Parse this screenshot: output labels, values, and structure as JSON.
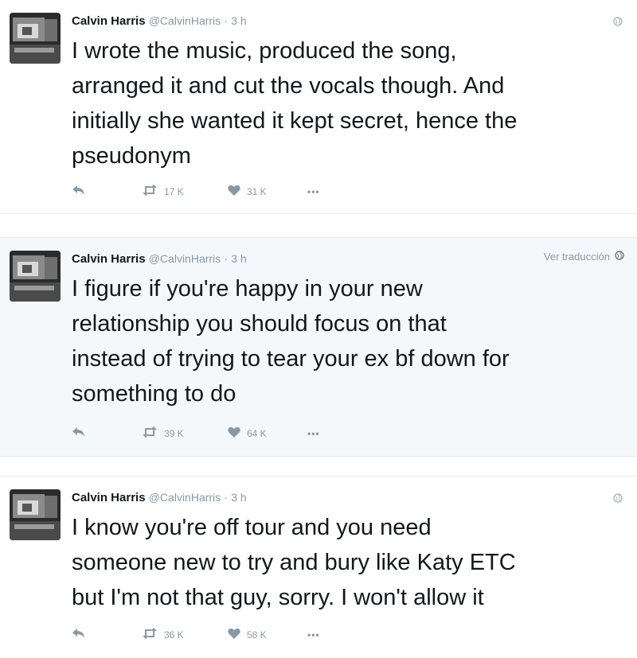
{
  "tweets": [
    {
      "name": "Calvin Harris",
      "handle": "@CalvinHarris",
      "separator": "·",
      "time": "3 h",
      "text": "I wrote the music, produced the song,\narranged it and cut the vocals though. And\ninitially she wanted it kept secret, hence the\npseudonym",
      "retweets": "17 K",
      "likes": "31 K",
      "more": "•••",
      "translate_label": ""
    },
    {
      "name": "Calvin Harris",
      "handle": "@CalvinHarris",
      "separator": "·",
      "time": "3 h",
      "text": "I figure if you're happy in your new\nrelationship you should focus on that\ninstead of trying to tear your ex bf down for\nsomething to do",
      "retweets": "39 K",
      "likes": "64 K",
      "more": "•••",
      "translate_label": "Ver traducción"
    },
    {
      "name": "Calvin Harris",
      "handle": "@CalvinHarris",
      "separator": "·",
      "time": "3 h",
      "text": "I know you're off tour and you need\nsomeone new to try and bury like Katy ETC\nbut I'm not that guy, sorry. I won't allow it",
      "retweets": "36 K",
      "likes": "58 K",
      "more": "•••",
      "translate_label": ""
    }
  ],
  "icons": {
    "reply": "reply-icon",
    "retweet": "retweet-icon",
    "like": "heart-icon",
    "more": "more-icon",
    "globe": "globe-icon"
  },
  "colors": {
    "text": "#14171a",
    "muted": "#8899a6",
    "highlight_bg": "#f5f8fa"
  }
}
